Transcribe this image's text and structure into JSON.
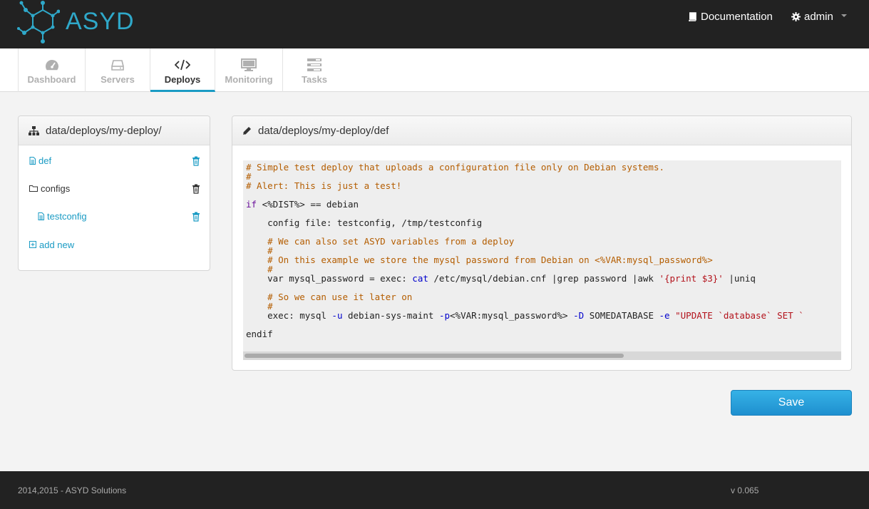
{
  "app": {
    "logo_text": "ASYD",
    "accent_color": "#1a9bc4"
  },
  "header": {
    "documentation_label": "Documentation",
    "documentation_icon": "book-icon",
    "user_label": "admin",
    "user_icon": "gear-icon"
  },
  "nav": {
    "tabs": [
      {
        "label": "Dashboard",
        "icon": "dashboard-icon",
        "active": false
      },
      {
        "label": "Servers",
        "icon": "hdd-icon",
        "active": false
      },
      {
        "label": "Deploys",
        "icon": "code-icon",
        "active": true
      },
      {
        "label": "Monitoring",
        "icon": "desktop-icon",
        "active": false
      },
      {
        "label": "Tasks",
        "icon": "tasks-icon",
        "active": false
      }
    ]
  },
  "file_tree": {
    "title": "data/deploys/my-deploy/",
    "items": [
      {
        "label": "def",
        "type": "file"
      },
      {
        "label": "configs",
        "type": "folder"
      },
      {
        "label": "testconfig",
        "type": "file"
      }
    ],
    "add_new_label": "add new"
  },
  "editor": {
    "title": "data/deploys/my-deploy/def",
    "lines": [
      "# Simple test deploy that uploads a configuration file only on Debian systems.",
      "#",
      "# Alert: This is just a test!",
      "if <%DIST%> == debian",
      "    config file: testconfig, /tmp/testconfig",
      "    # We can also set ASYD variables from a deploy",
      "    #",
      "    # On this example we store the mysql password from Debian on <%VAR:mysql_password%>",
      "    #",
      "    var mysql_password = exec: cat /etc/mysql/debian.cnf |grep password |awk '{print $3}' |uniq",
      "    # So we can use it later on",
      "    #",
      "    exec: mysql -u debian-sys-maint -p<%VAR:mysql_password%> -D SOMEDATABASE -e \"UPDATE `database` SET `",
      "endif"
    ]
  },
  "actions": {
    "save_label": "Save"
  },
  "footer": {
    "copyright": "2014,2015 - ASYD Solutions",
    "version": "v 0.065"
  }
}
